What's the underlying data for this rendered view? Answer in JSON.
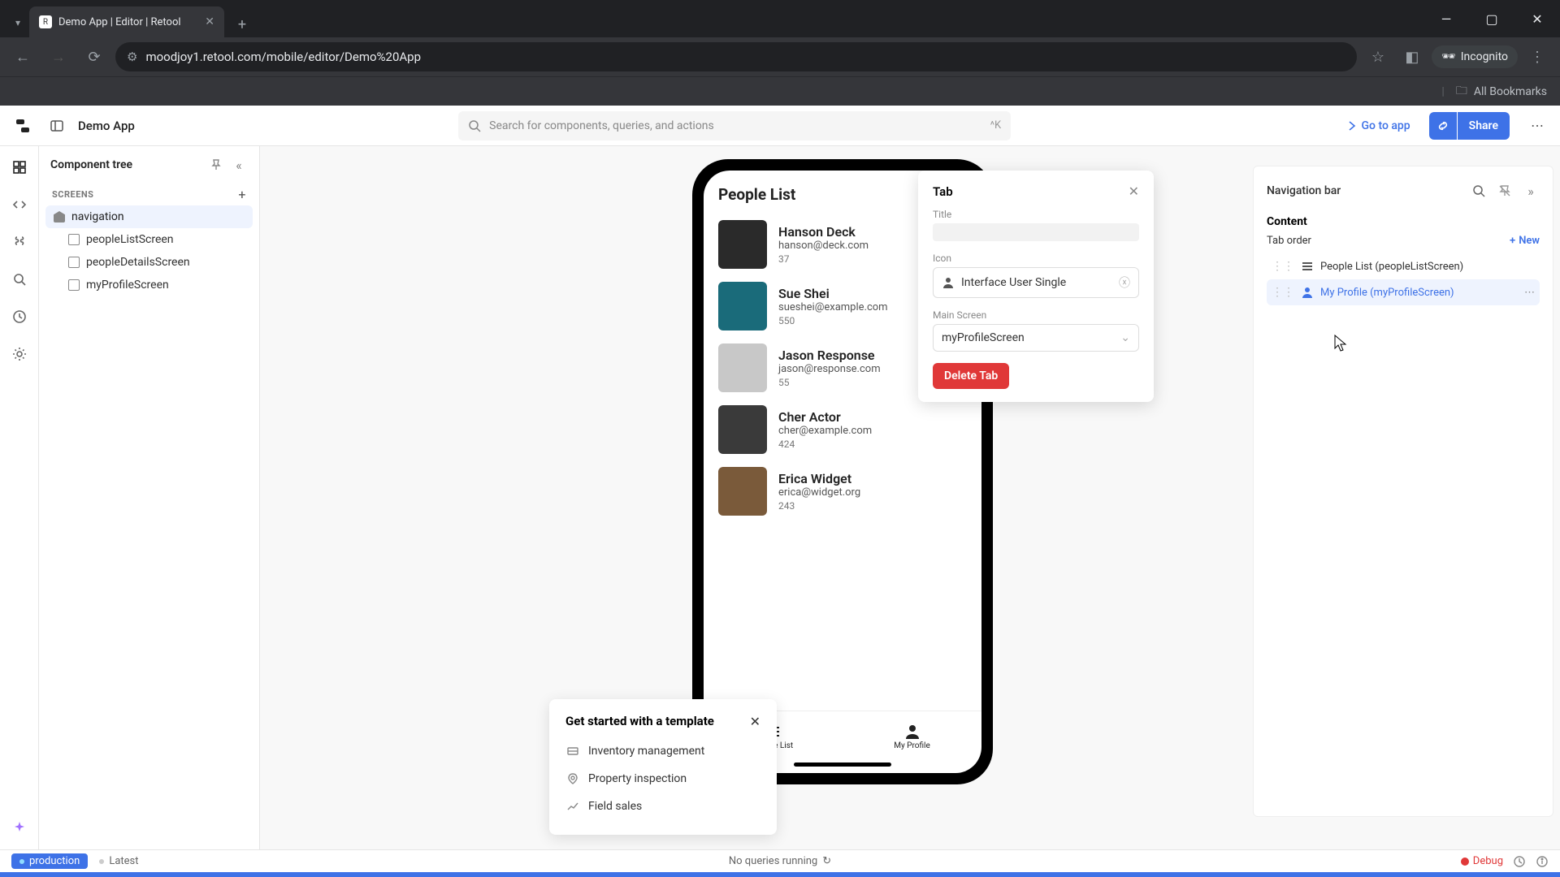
{
  "browser": {
    "tab_title": "Demo App | Editor | Retool",
    "url": "moodjoy1.retool.com/mobile/editor/Demo%20App",
    "incognito": "Incognito",
    "all_bookmarks": "All Bookmarks"
  },
  "appbar": {
    "title": "Demo App",
    "search_placeholder": "Search for components, queries, and actions",
    "search_kbd": "^K",
    "goto": "Go to app",
    "share": "Share"
  },
  "left_panel": {
    "title": "Component tree",
    "section": "SCREENS",
    "items": [
      {
        "label": "navigation",
        "selected": true
      },
      {
        "label": "peopleListScreen",
        "selected": false
      },
      {
        "label": "peopleDetailsScreen",
        "selected": false
      },
      {
        "label": "myProfileScreen",
        "selected": false
      }
    ]
  },
  "phone": {
    "title": "People List",
    "people": [
      {
        "name": "Hanson Deck",
        "email": "hanson@deck.com",
        "num": "37"
      },
      {
        "name": "Sue Shei",
        "email": "sueshei@example.com",
        "num": "550"
      },
      {
        "name": "Jason Response",
        "email": "jason@response.com",
        "num": "55"
      },
      {
        "name": "Cher Actor",
        "email": "cher@example.com",
        "num": "424"
      },
      {
        "name": "Erica Widget",
        "email": "erica@widget.org",
        "num": "243"
      }
    ],
    "tabs": [
      {
        "label": "People List"
      },
      {
        "label": "My Profile"
      }
    ]
  },
  "popover": {
    "title": "Tab",
    "title_label": "Title",
    "icon_label": "Icon",
    "icon_value": "Interface User Single",
    "main_label": "Main Screen",
    "main_value": "myProfileScreen",
    "delete": "Delete Tab"
  },
  "right": {
    "title": "Navigation bar",
    "section": "Content",
    "tab_order": "Tab order",
    "new": "New",
    "tabs": [
      {
        "label": "People List (peopleListScreen)",
        "selected": false
      },
      {
        "label": "My Profile (myProfileScreen)",
        "selected": true
      }
    ]
  },
  "templates": {
    "title": "Get started with a template",
    "items": [
      {
        "label": "Inventory management"
      },
      {
        "label": "Property inspection"
      },
      {
        "label": "Field sales"
      }
    ]
  },
  "status": {
    "env": "production",
    "latest": "Latest",
    "queries": "No queries running",
    "debug": "Debug"
  }
}
